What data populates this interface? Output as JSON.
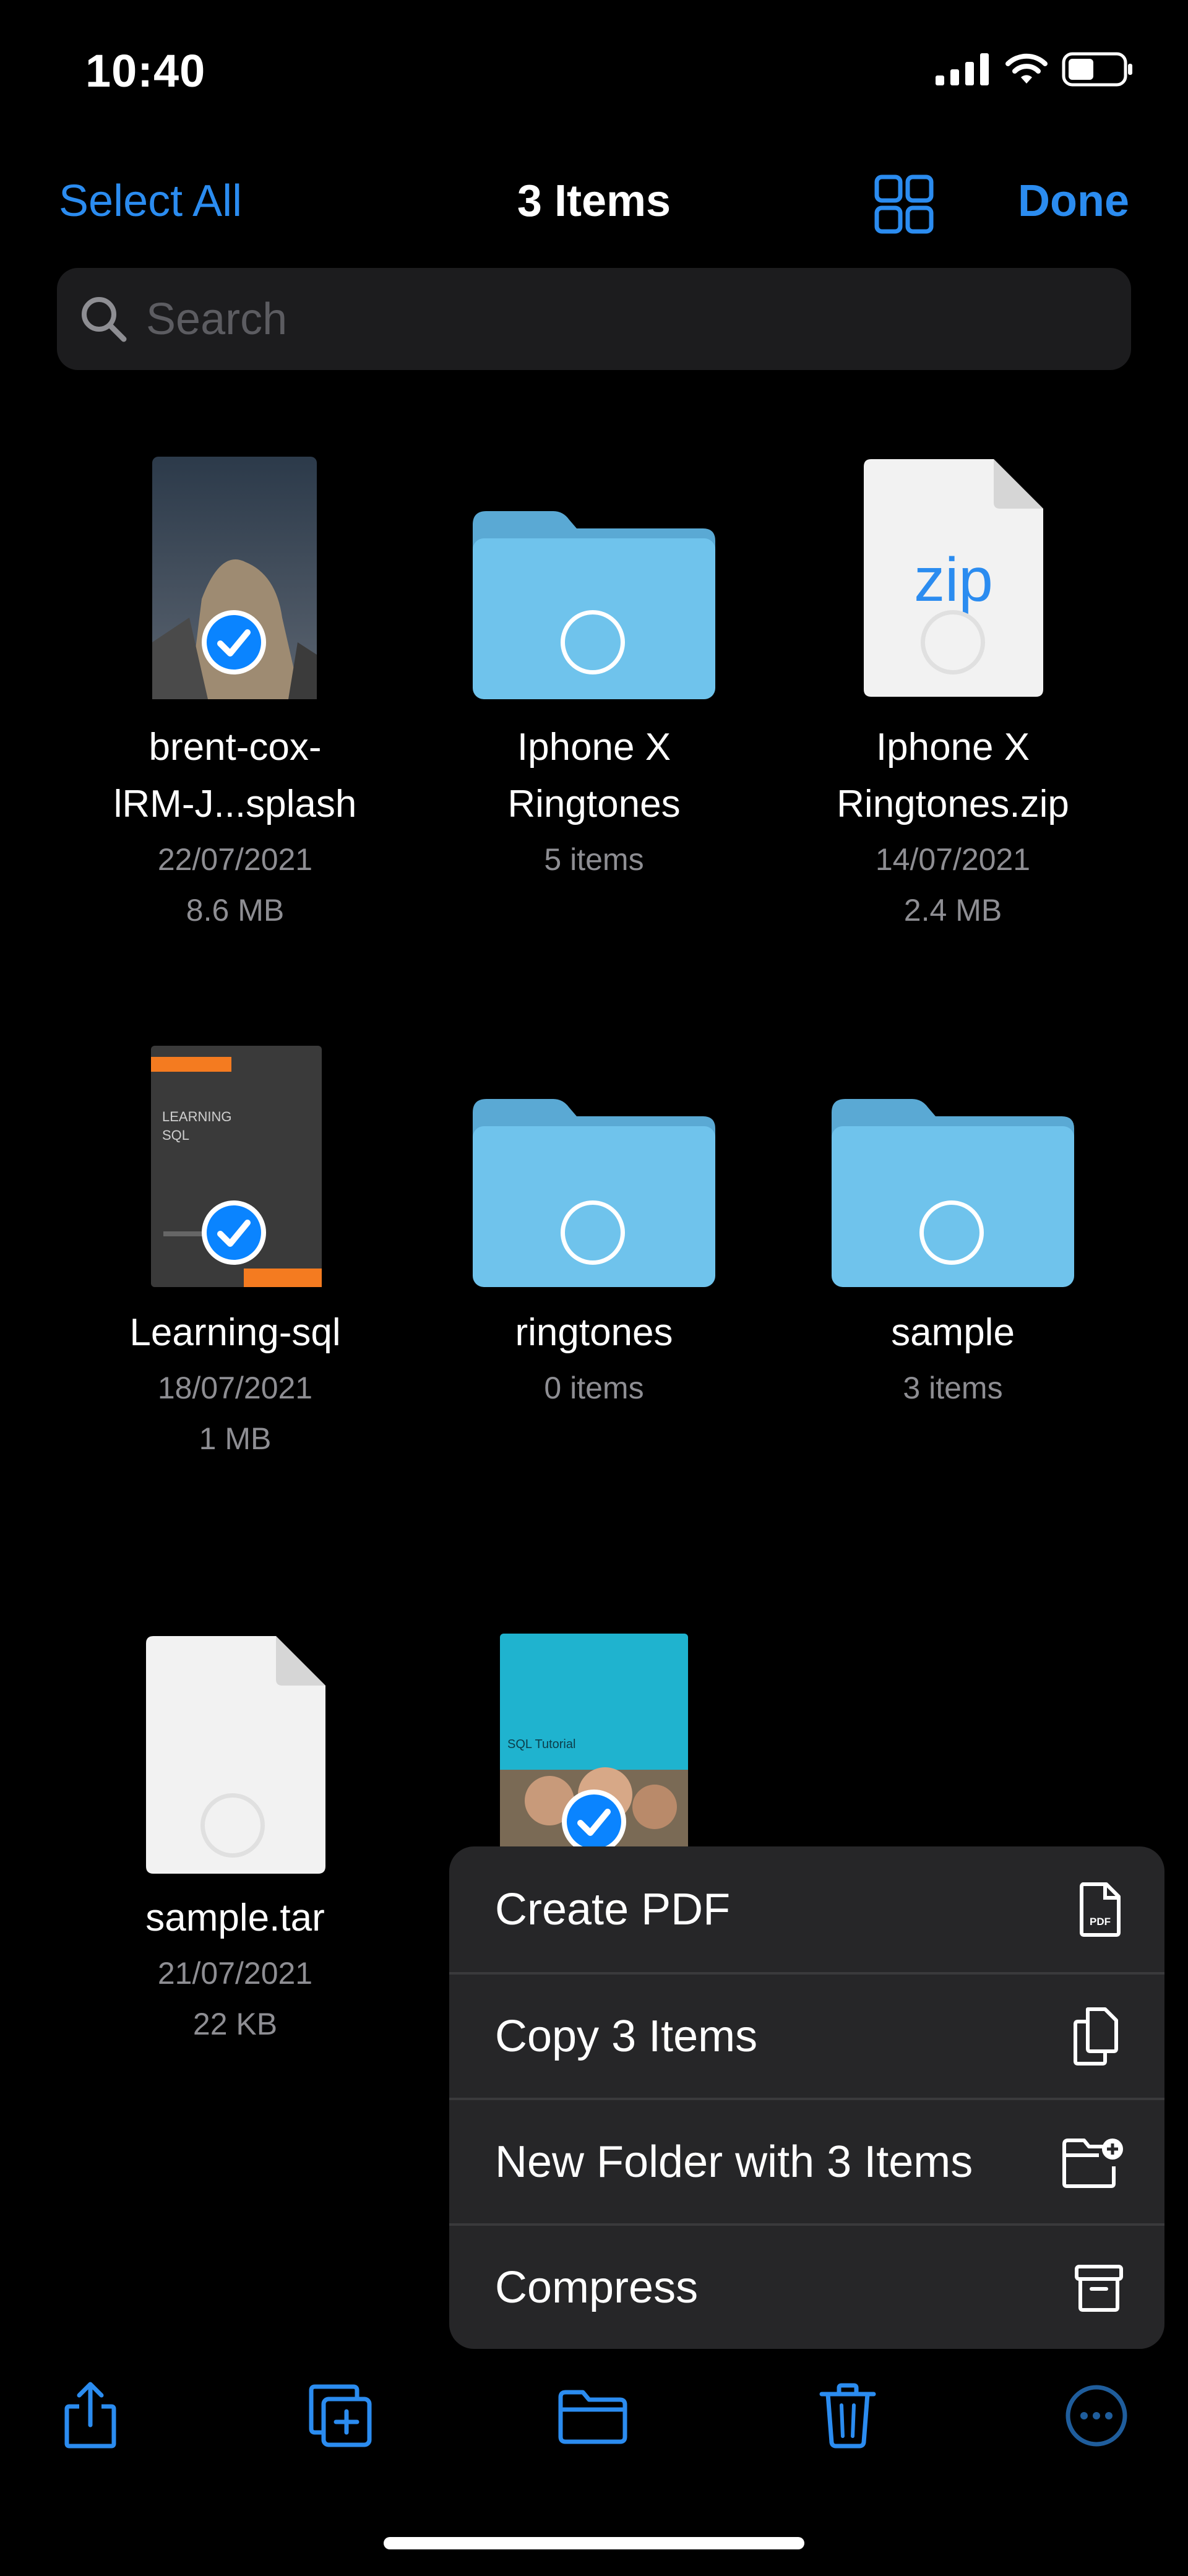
{
  "status_bar": {
    "time": "10:40"
  },
  "nav": {
    "select_all": "Select All",
    "title": "3 Items",
    "done": "Done"
  },
  "search": {
    "placeholder": "Search"
  },
  "items": [
    {
      "name_line1": "brent-cox-",
      "name_line2": "lRM-J...splash",
      "date": "22/07/2021",
      "size": "8.6 MB",
      "selected": true,
      "kind": "image"
    },
    {
      "name_line1": "Iphone X",
      "name_line2": "Ringtones",
      "count": "5 items",
      "selected": false,
      "kind": "folder"
    },
    {
      "name_line1": "Iphone X",
      "name_line2": "Ringtones.zip",
      "date": "14/07/2021",
      "size": "2.4 MB",
      "selected": false,
      "kind": "zip",
      "badge": "zip"
    },
    {
      "name_line1": "Learning-sql",
      "date": "18/07/2021",
      "size": "1 MB",
      "selected": true,
      "kind": "book",
      "cover_text": "LEARNING SQL"
    },
    {
      "name_line1": "ringtones",
      "count": "0 items",
      "selected": false,
      "kind": "folder"
    },
    {
      "name_line1": "sample",
      "count": "3 items",
      "selected": false,
      "kind": "folder"
    },
    {
      "name_line1": "sample.tar",
      "date": "21/07/2021",
      "size": "22 KB",
      "selected": false,
      "kind": "document"
    },
    {
      "selected": true,
      "kind": "image-cover",
      "cover_text": "SQL Tutorial"
    }
  ],
  "menu": [
    {
      "label": "Create PDF",
      "icon": "pdf-icon",
      "icon_text": "PDF"
    },
    {
      "label": "Copy 3 Items",
      "icon": "copy-icon"
    },
    {
      "label": "New Folder with 3 Items",
      "icon": "new-folder-icon"
    },
    {
      "label": "Compress",
      "icon": "archive-icon"
    }
  ],
  "toolbar": [
    {
      "name": "share-button",
      "icon": "share-icon"
    },
    {
      "name": "duplicate-button",
      "icon": "duplicate-icon"
    },
    {
      "name": "move-button",
      "icon": "folder-icon"
    },
    {
      "name": "delete-button",
      "icon": "trash-icon"
    },
    {
      "name": "more-button",
      "icon": "ellipsis-icon"
    }
  ],
  "colors": {
    "accent": "#2b8cf0",
    "folder": "#6fc3ec",
    "folder_tab": "#5aa9d4",
    "check": "#0a84ff",
    "menu_bg": "#262628"
  }
}
